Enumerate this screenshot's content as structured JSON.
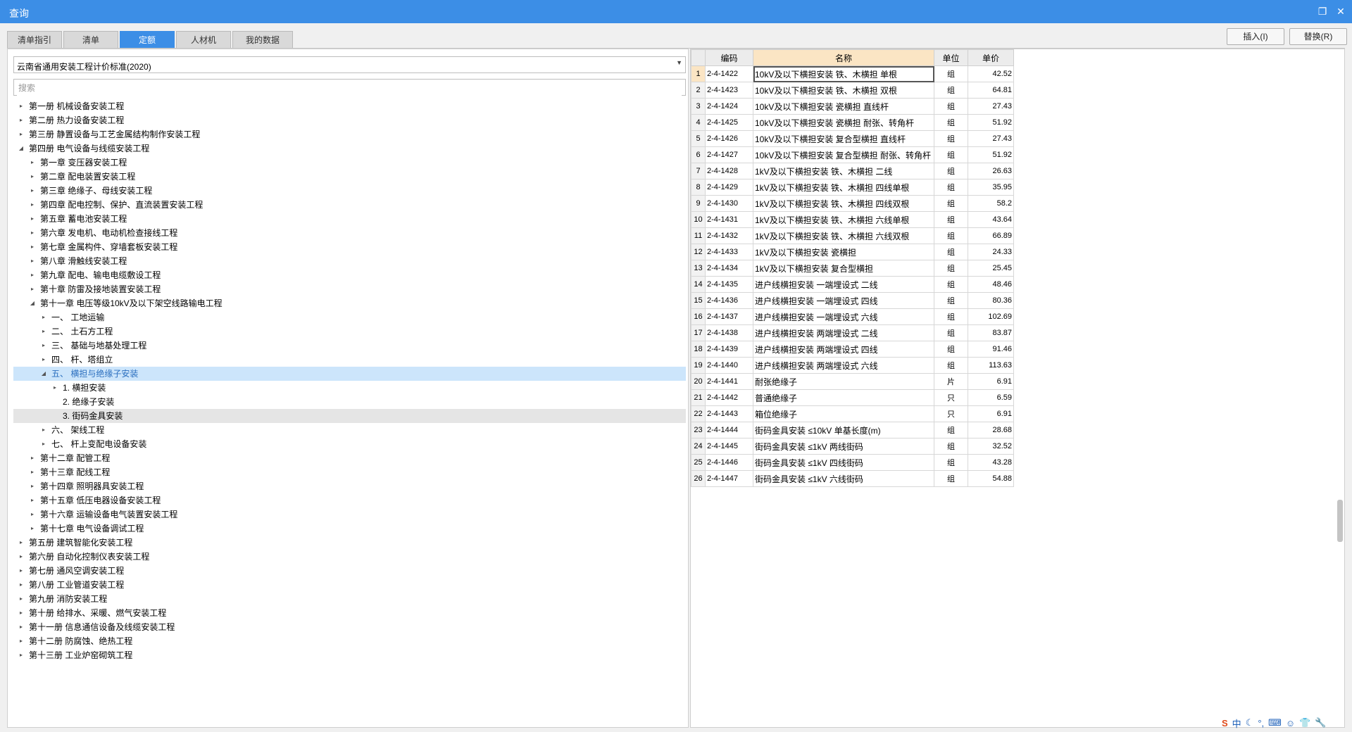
{
  "window": {
    "title": "查询",
    "restore_icon": "restore-icon",
    "close_icon": "close-icon"
  },
  "tabs": [
    {
      "label": "清单指引",
      "active": false
    },
    {
      "label": "清单",
      "active": false
    },
    {
      "label": "定额",
      "active": true
    },
    {
      "label": "人材机",
      "active": false
    },
    {
      "label": "我的数据",
      "active": false
    }
  ],
  "actions": {
    "insert": "插入(I)",
    "replace": "替换(R)"
  },
  "left": {
    "standard_select": "云南省通用安装工程计价标准(2020)",
    "search_placeholder": "搜索"
  },
  "tree": [
    {
      "label": "第一册 机械设备安装工程",
      "level": 0,
      "toggle": "collapsed"
    },
    {
      "label": "第二册 热力设备安装工程",
      "level": 0,
      "toggle": "collapsed"
    },
    {
      "label": "第三册 静置设备与工艺金属结构制作安装工程",
      "level": 0,
      "toggle": "collapsed"
    },
    {
      "label": "第四册 电气设备与线缆安装工程",
      "level": 0,
      "toggle": "expanded"
    },
    {
      "label": "第一章 变压器安装工程",
      "level": 1,
      "toggle": "collapsed"
    },
    {
      "label": "第二章 配电装置安装工程",
      "level": 1,
      "toggle": "collapsed"
    },
    {
      "label": "第三章 绝缘子、母线安装工程",
      "level": 1,
      "toggle": "collapsed"
    },
    {
      "label": "第四章 配电控制、保护、直流装置安装工程",
      "level": 1,
      "toggle": "collapsed"
    },
    {
      "label": "第五章 蓄电池安装工程",
      "level": 1,
      "toggle": "collapsed"
    },
    {
      "label": "第六章 发电机、电动机检查接线工程",
      "level": 1,
      "toggle": "collapsed"
    },
    {
      "label": "第七章 金属构件、穿墙套板安装工程",
      "level": 1,
      "toggle": "collapsed"
    },
    {
      "label": "第八章 滑触线安装工程",
      "level": 1,
      "toggle": "collapsed"
    },
    {
      "label": "第九章 配电、输电电缆敷设工程",
      "level": 1,
      "toggle": "collapsed"
    },
    {
      "label": "第十章 防雷及接地装置安装工程",
      "level": 1,
      "toggle": "collapsed"
    },
    {
      "label": "第十一章 电压等级10kV及以下架空线路输电工程",
      "level": 1,
      "toggle": "expanded"
    },
    {
      "label": "一、 工地运输",
      "level": 2,
      "toggle": "collapsed"
    },
    {
      "label": "二、 土石方工程",
      "level": 2,
      "toggle": "collapsed"
    },
    {
      "label": "三、 基础与地基处理工程",
      "level": 2,
      "toggle": "collapsed"
    },
    {
      "label": "四、 杆、塔组立",
      "level": 2,
      "toggle": "collapsed"
    },
    {
      "label": "五、 横担与绝缘子安装",
      "level": 2,
      "toggle": "expanded",
      "state": "selected"
    },
    {
      "label": "1. 横担安装",
      "level": 3,
      "toggle": "collapsed"
    },
    {
      "label": "2. 绝缘子安装",
      "level": 3,
      "toggle": "none"
    },
    {
      "label": "3. 街码金具安装",
      "level": 3,
      "toggle": "none",
      "state": "hover"
    },
    {
      "label": "六、 架线工程",
      "level": 2,
      "toggle": "collapsed"
    },
    {
      "label": "七、 杆上变配电设备安装",
      "level": 2,
      "toggle": "collapsed"
    },
    {
      "label": "第十二章 配管工程",
      "level": 1,
      "toggle": "collapsed"
    },
    {
      "label": "第十三章 配线工程",
      "level": 1,
      "toggle": "collapsed"
    },
    {
      "label": "第十四章 照明器具安装工程",
      "level": 1,
      "toggle": "collapsed"
    },
    {
      "label": "第十五章 低压电器设备安装工程",
      "level": 1,
      "toggle": "collapsed"
    },
    {
      "label": "第十六章 运输设备电气装置安装工程",
      "level": 1,
      "toggle": "collapsed"
    },
    {
      "label": "第十七章 电气设备调试工程",
      "level": 1,
      "toggle": "collapsed"
    },
    {
      "label": "第五册 建筑智能化安装工程",
      "level": 0,
      "toggle": "collapsed"
    },
    {
      "label": "第六册 自动化控制仪表安装工程",
      "level": 0,
      "toggle": "collapsed"
    },
    {
      "label": "第七册 通风空调安装工程",
      "level": 0,
      "toggle": "collapsed"
    },
    {
      "label": "第八册 工业管道安装工程",
      "level": 0,
      "toggle": "collapsed"
    },
    {
      "label": "第九册 消防安装工程",
      "level": 0,
      "toggle": "collapsed"
    },
    {
      "label": "第十册 给排水、采暖、燃气安装工程",
      "level": 0,
      "toggle": "collapsed"
    },
    {
      "label": "第十一册 信息通信设备及线缆安装工程",
      "level": 0,
      "toggle": "collapsed"
    },
    {
      "label": "第十二册 防腐蚀、绝热工程",
      "level": 0,
      "toggle": "collapsed"
    },
    {
      "label": "第十三册 工业炉窑砌筑工程",
      "level": 0,
      "toggle": "collapsed"
    }
  ],
  "grid": {
    "headers": {
      "code": "编码",
      "name": "名称",
      "unit": "单位",
      "price": "单价"
    },
    "rows": [
      {
        "n": "1",
        "code": "2-4-1422",
        "name": "10kV及以下横担安装 铁、木横担 单根",
        "unit": "组",
        "price": "42.52"
      },
      {
        "n": "2",
        "code": "2-4-1423",
        "name": "10kV及以下横担安装 铁、木横担 双根",
        "unit": "组",
        "price": "64.81"
      },
      {
        "n": "3",
        "code": "2-4-1424",
        "name": "10kV及以下横担安装 瓷横担 直线杆",
        "unit": "组",
        "price": "27.43"
      },
      {
        "n": "4",
        "code": "2-4-1425",
        "name": "10kV及以下横担安装 瓷横担 耐张、转角杆",
        "unit": "组",
        "price": "51.92"
      },
      {
        "n": "5",
        "code": "2-4-1426",
        "name": "10kV及以下横担安装 复合型横担 直线杆",
        "unit": "组",
        "price": "27.43"
      },
      {
        "n": "6",
        "code": "2-4-1427",
        "name": "10kV及以下横担安装 复合型横担 耐张、转角杆",
        "unit": "组",
        "price": "51.92"
      },
      {
        "n": "7",
        "code": "2-4-1428",
        "name": "1kV及以下横担安装 铁、木横担 二线",
        "unit": "组",
        "price": "26.63"
      },
      {
        "n": "8",
        "code": "2-4-1429",
        "name": "1kV及以下横担安装 铁、木横担 四线单根",
        "unit": "组",
        "price": "35.95"
      },
      {
        "n": "9",
        "code": "2-4-1430",
        "name": "1kV及以下横担安装 铁、木横担 四线双根",
        "unit": "组",
        "price": "58.2"
      },
      {
        "n": "10",
        "code": "2-4-1431",
        "name": "1kV及以下横担安装 铁、木横担 六线单根",
        "unit": "组",
        "price": "43.64"
      },
      {
        "n": "11",
        "code": "2-4-1432",
        "name": "1kV及以下横担安装 铁、木横担 六线双根",
        "unit": "组",
        "price": "66.89"
      },
      {
        "n": "12",
        "code": "2-4-1433",
        "name": "1kV及以下横担安装 瓷横担",
        "unit": "组",
        "price": "24.33"
      },
      {
        "n": "13",
        "code": "2-4-1434",
        "name": "1kV及以下横担安装 复合型横担",
        "unit": "组",
        "price": "25.45"
      },
      {
        "n": "14",
        "code": "2-4-1435",
        "name": "进户线横担安装 一端埋设式 二线",
        "unit": "组",
        "price": "48.46"
      },
      {
        "n": "15",
        "code": "2-4-1436",
        "name": "进户线横担安装 一端埋设式 四线",
        "unit": "组",
        "price": "80.36"
      },
      {
        "n": "16",
        "code": "2-4-1437",
        "name": "进户线横担安装 一端埋设式 六线",
        "unit": "组",
        "price": "102.69"
      },
      {
        "n": "17",
        "code": "2-4-1438",
        "name": "进户线横担安装 两端埋设式 二线",
        "unit": "组",
        "price": "83.87"
      },
      {
        "n": "18",
        "code": "2-4-1439",
        "name": "进户线横担安装 两端埋设式 四线",
        "unit": "组",
        "price": "91.46"
      },
      {
        "n": "19",
        "code": "2-4-1440",
        "name": "进户线横担安装 两端埋设式 六线",
        "unit": "组",
        "price": "113.63"
      },
      {
        "n": "20",
        "code": "2-4-1441",
        "name": "耐张绝缘子",
        "unit": "片",
        "price": "6.91"
      },
      {
        "n": "21",
        "code": "2-4-1442",
        "name": "普通绝缘子",
        "unit": "只",
        "price": "6.59"
      },
      {
        "n": "22",
        "code": "2-4-1443",
        "name": "箱位绝缘子",
        "unit": "只",
        "price": "6.91"
      },
      {
        "n": "23",
        "code": "2-4-1444",
        "name": "街码金具安装 ≤10kV 单基长度(m)",
        "unit": "组",
        "price": "28.68"
      },
      {
        "n": "24",
        "code": "2-4-1445",
        "name": "街码金具安装 ≤1kV 两线街码",
        "unit": "组",
        "price": "32.52"
      },
      {
        "n": "25",
        "code": "2-4-1446",
        "name": "街码金具安装 ≤1kV 四线街码",
        "unit": "组",
        "price": "43.28"
      },
      {
        "n": "26",
        "code": "2-4-1447",
        "name": "街码金具安装 ≤1kV 六线街码",
        "unit": "组",
        "price": "54.88"
      }
    ],
    "current_row": 1
  },
  "tray": {
    "ime": "中",
    "ime_logo": "sogou-s-icon"
  },
  "colors": {
    "accent": "#3c8ee6",
    "selected_bg": "#cce5fb",
    "header_name_bg": "#fbe5c4"
  }
}
